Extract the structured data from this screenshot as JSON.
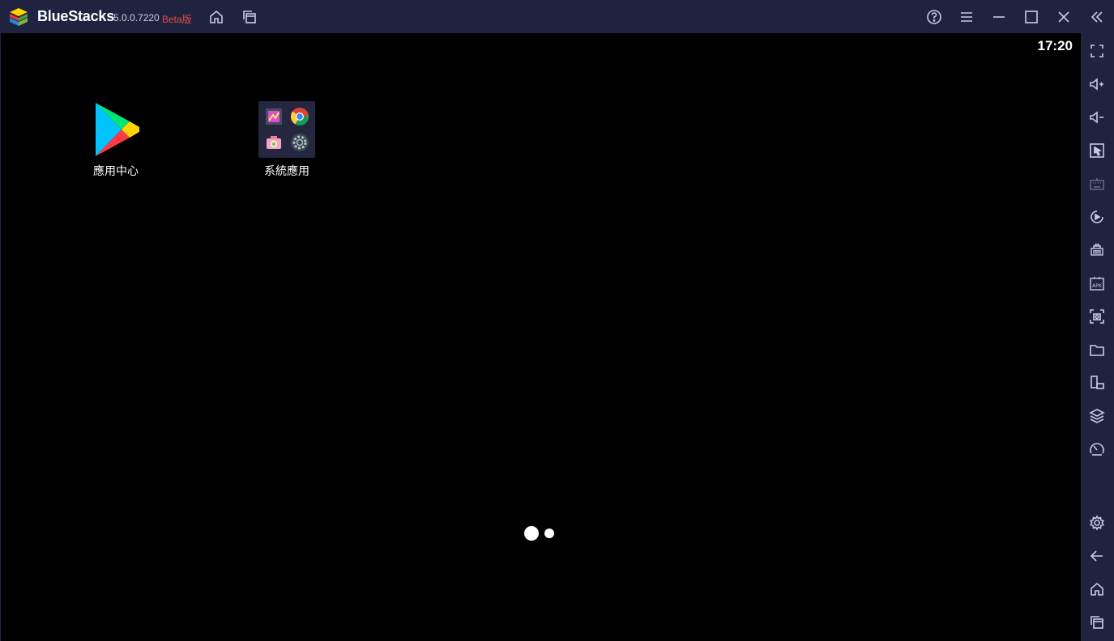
{
  "titlebar": {
    "app_name": "BlueStacks",
    "version": "5.0.0.7220",
    "beta": "Beta版",
    "icons": [
      "home-icon",
      "multi-instance-icon",
      "help-icon",
      "menu-icon",
      "minimize-icon",
      "maximize-icon",
      "close-icon",
      "collapse-sidebar-icon"
    ]
  },
  "screen": {
    "clock": "17:20",
    "apps": [
      {
        "label": "應用中心",
        "icon": "play-store-icon"
      },
      {
        "label": "系統應用",
        "icon": "system-apps-folder-icon"
      }
    ]
  },
  "sidebar": {
    "icons": [
      "fullscreen-icon",
      "volume-up-icon",
      "volume-down-icon",
      "pointer-icon",
      "keyboard-icon",
      "macro-record-icon",
      "multi-instance-manager-icon",
      "apk-install-icon",
      "screenshot-icon",
      "folder-icon",
      "rotate-icon",
      "layers-icon",
      "performance-icon",
      "settings-icon",
      "back-icon",
      "home-icon",
      "recent-apps-icon"
    ]
  },
  "colors": {
    "chrome": "#1f2340",
    "screen_bg": "#000000",
    "beta_red": "#e24d4d",
    "icon": "#c8cbe0"
  }
}
